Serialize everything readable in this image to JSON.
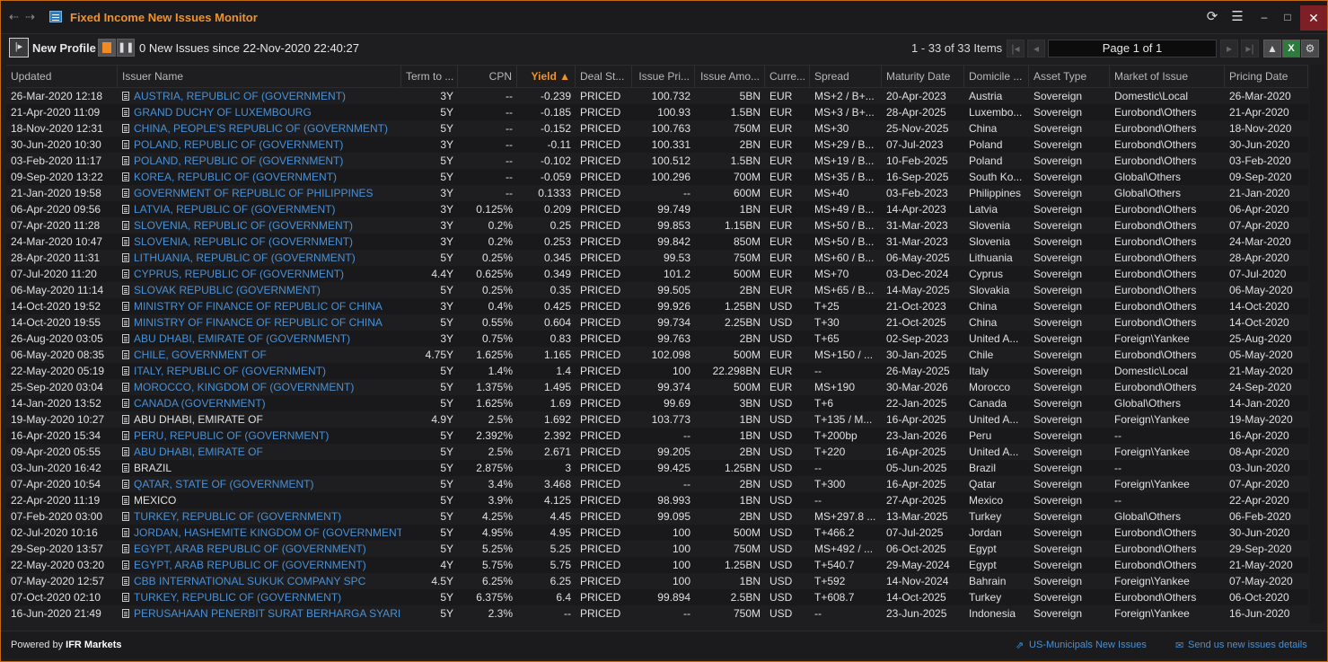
{
  "window": {
    "title": "Fixed Income New Issues Monitor",
    "back_icon": "arrow-left-icon",
    "forward_icon": "arrow-right-icon",
    "refresh_icon": "refresh-icon",
    "menu_icon": "hamburger-icon",
    "minimize": "‒",
    "maximize": "□",
    "close": "✕"
  },
  "toolbar": {
    "profile_label": "New Profile",
    "new_issues_text": "0 New Issues since 22-Nov-2020 22:40:27",
    "items_info": "1 - 33 of 33 Items",
    "page_label": "Page 1 of 1",
    "first_page": "|◂",
    "prev_page": "◂",
    "next_page": "▸",
    "last_page": "▸|"
  },
  "columns": [
    {
      "key": "updated",
      "label": "Updated"
    },
    {
      "key": "issuer",
      "label": "Issuer Name"
    },
    {
      "key": "term",
      "label": "Term to ..."
    },
    {
      "key": "cpn",
      "label": "CPN"
    },
    {
      "key": "yield",
      "label": "Yield ▲"
    },
    {
      "key": "deal",
      "label": "Deal St..."
    },
    {
      "key": "price",
      "label": "Issue Pri..."
    },
    {
      "key": "amount",
      "label": "Issue Amo..."
    },
    {
      "key": "curr",
      "label": "Curre..."
    },
    {
      "key": "spread",
      "label": "Spread"
    },
    {
      "key": "maturity",
      "label": "Maturity Date"
    },
    {
      "key": "domicile",
      "label": "Domicile ..."
    },
    {
      "key": "asset",
      "label": "Asset Type"
    },
    {
      "key": "market",
      "label": "Market of Issue"
    },
    {
      "key": "pricing",
      "label": "Pricing Date"
    }
  ],
  "rows": [
    {
      "updated": "26-Mar-2020 12:18",
      "issuer": "AUSTRIA, REPUBLIC OF (GOVERNMENT)",
      "link": true,
      "term": "3Y",
      "cpn": "--",
      "yield": "-0.239",
      "deal": "PRICED",
      "price": "100.732",
      "amount": "5BN",
      "curr": "EUR",
      "spread": "MS+2 / B+...",
      "maturity": "20-Apr-2023",
      "domicile": "Austria",
      "asset": "Sovereign",
      "market": "Domestic\\Local",
      "pricing": "26-Mar-2020"
    },
    {
      "updated": "21-Apr-2020 11:09",
      "issuer": "GRAND DUCHY OF LUXEMBOURG",
      "link": true,
      "term": "5Y",
      "cpn": "--",
      "yield": "-0.185",
      "deal": "PRICED",
      "price": "100.93",
      "amount": "1.5BN",
      "curr": "EUR",
      "spread": "MS+3 / B+...",
      "maturity": "28-Apr-2025",
      "domicile": "Luxembo...",
      "asset": "Sovereign",
      "market": "Eurobond\\Others",
      "pricing": "21-Apr-2020"
    },
    {
      "updated": "18-Nov-2020 12:31",
      "issuer": "CHINA, PEOPLE'S REPUBLIC OF (GOVERNMENT)",
      "link": true,
      "term": "5Y",
      "cpn": "--",
      "yield": "-0.152",
      "deal": "PRICED",
      "price": "100.763",
      "amount": "750M",
      "curr": "EUR",
      "spread": "MS+30",
      "maturity": "25-Nov-2025",
      "domicile": "China",
      "asset": "Sovereign",
      "market": "Eurobond\\Others",
      "pricing": "18-Nov-2020"
    },
    {
      "updated": "30-Jun-2020 10:30",
      "issuer": "POLAND, REPUBLIC OF (GOVERNMENT)",
      "link": true,
      "term": "3Y",
      "cpn": "--",
      "yield": "-0.11",
      "deal": "PRICED",
      "price": "100.331",
      "amount": "2BN",
      "curr": "EUR",
      "spread": "MS+29 / B...",
      "maturity": "07-Jul-2023",
      "domicile": "Poland",
      "asset": "Sovereign",
      "market": "Eurobond\\Others",
      "pricing": "30-Jun-2020"
    },
    {
      "updated": "03-Feb-2020 11:17",
      "issuer": "POLAND, REPUBLIC OF (GOVERNMENT)",
      "link": true,
      "term": "5Y",
      "cpn": "--",
      "yield": "-0.102",
      "deal": "PRICED",
      "price": "100.512",
      "amount": "1.5BN",
      "curr": "EUR",
      "spread": "MS+19 / B...",
      "maturity": "10-Feb-2025",
      "domicile": "Poland",
      "asset": "Sovereign",
      "market": "Eurobond\\Others",
      "pricing": "03-Feb-2020"
    },
    {
      "updated": "09-Sep-2020 13:22",
      "issuer": "KOREA, REPUBLIC OF (GOVERNMENT)",
      "link": true,
      "term": "5Y",
      "cpn": "--",
      "yield": "-0.059",
      "deal": "PRICED",
      "price": "100.296",
      "amount": "700M",
      "curr": "EUR",
      "spread": "MS+35 / B...",
      "maturity": "16-Sep-2025",
      "domicile": "South Ko...",
      "asset": "Sovereign",
      "market": "Global\\Others",
      "pricing": "09-Sep-2020"
    },
    {
      "updated": "21-Jan-2020 19:58",
      "issuer": "GOVERNMENT OF REPUBLIC OF PHILIPPINES",
      "link": true,
      "term": "3Y",
      "cpn": "--",
      "yield": "0.1333",
      "deal": "PRICED",
      "price": "--",
      "amount": "600M",
      "curr": "EUR",
      "spread": "MS+40",
      "maturity": "03-Feb-2023",
      "domicile": "Philippines",
      "asset": "Sovereign",
      "market": "Global\\Others",
      "pricing": "21-Jan-2020"
    },
    {
      "updated": "06-Apr-2020 09:56",
      "issuer": "LATVIA, REPUBLIC OF (GOVERNMENT)",
      "link": true,
      "term": "3Y",
      "cpn": "0.125%",
      "yield": "0.209",
      "deal": "PRICED",
      "price": "99.749",
      "amount": "1BN",
      "curr": "EUR",
      "spread": "MS+49 / B...",
      "maturity": "14-Apr-2023",
      "domicile": "Latvia",
      "asset": "Sovereign",
      "market": "Eurobond\\Others",
      "pricing": "06-Apr-2020"
    },
    {
      "updated": "07-Apr-2020 11:28",
      "issuer": "SLOVENIA, REPUBLIC OF (GOVERNMENT)",
      "link": true,
      "term": "3Y",
      "cpn": "0.2%",
      "yield": "0.25",
      "deal": "PRICED",
      "price": "99.853",
      "amount": "1.15BN",
      "curr": "EUR",
      "spread": "MS+50 / B...",
      "maturity": "31-Mar-2023",
      "domicile": "Slovenia",
      "asset": "Sovereign",
      "market": "Eurobond\\Others",
      "pricing": "07-Apr-2020"
    },
    {
      "updated": "24-Mar-2020 10:47",
      "issuer": "SLOVENIA, REPUBLIC OF (GOVERNMENT)",
      "link": true,
      "term": "3Y",
      "cpn": "0.2%",
      "yield": "0.253",
      "deal": "PRICED",
      "price": "99.842",
      "amount": "850M",
      "curr": "EUR",
      "spread": "MS+50 / B...",
      "maturity": "31-Mar-2023",
      "domicile": "Slovenia",
      "asset": "Sovereign",
      "market": "Eurobond\\Others",
      "pricing": "24-Mar-2020"
    },
    {
      "updated": "28-Apr-2020 11:31",
      "issuer": "LITHUANIA, REPUBLIC OF (GOVERNMENT)",
      "link": true,
      "term": "5Y",
      "cpn": "0.25%",
      "yield": "0.345",
      "deal": "PRICED",
      "price": "99.53",
      "amount": "750M",
      "curr": "EUR",
      "spread": "MS+60 / B...",
      "maturity": "06-May-2025",
      "domicile": "Lithuania",
      "asset": "Sovereign",
      "market": "Eurobond\\Others",
      "pricing": "28-Apr-2020"
    },
    {
      "updated": "07-Jul-2020 11:20",
      "issuer": "CYPRUS, REPUBLIC OF (GOVERNMENT)",
      "link": true,
      "term": "4.4Y",
      "cpn": "0.625%",
      "yield": "0.349",
      "deal": "PRICED",
      "price": "101.2",
      "amount": "500M",
      "curr": "EUR",
      "spread": "MS+70",
      "maturity": "03-Dec-2024",
      "domicile": "Cyprus",
      "asset": "Sovereign",
      "market": "Eurobond\\Others",
      "pricing": "07-Jul-2020"
    },
    {
      "updated": "06-May-2020 11:14",
      "issuer": "SLOVAK REPUBLIC (GOVERNMENT)",
      "link": true,
      "term": "5Y",
      "cpn": "0.25%",
      "yield": "0.35",
      "deal": "PRICED",
      "price": "99.505",
      "amount": "2BN",
      "curr": "EUR",
      "spread": "MS+65 / B...",
      "maturity": "14-May-2025",
      "domicile": "Slovakia",
      "asset": "Sovereign",
      "market": "Eurobond\\Others",
      "pricing": "06-May-2020"
    },
    {
      "updated": "14-Oct-2020 19:52",
      "issuer": "MINISTRY OF FINANCE OF REPUBLIC OF CHINA",
      "link": true,
      "term": "3Y",
      "cpn": "0.4%",
      "yield": "0.425",
      "deal": "PRICED",
      "price": "99.926",
      "amount": "1.25BN",
      "curr": "USD",
      "spread": "T+25",
      "maturity": "21-Oct-2023",
      "domicile": "China",
      "asset": "Sovereign",
      "market": "Eurobond\\Others",
      "pricing": "14-Oct-2020"
    },
    {
      "updated": "14-Oct-2020 19:55",
      "issuer": "MINISTRY OF FINANCE OF REPUBLIC OF CHINA",
      "link": true,
      "term": "5Y",
      "cpn": "0.55%",
      "yield": "0.604",
      "deal": "PRICED",
      "price": "99.734",
      "amount": "2.25BN",
      "curr": "USD",
      "spread": "T+30",
      "maturity": "21-Oct-2025",
      "domicile": "China",
      "asset": "Sovereign",
      "market": "Eurobond\\Others",
      "pricing": "14-Oct-2020"
    },
    {
      "updated": "26-Aug-2020 03:05",
      "issuer": "ABU DHABI, EMIRATE OF (GOVERNMENT)",
      "link": true,
      "term": "3Y",
      "cpn": "0.75%",
      "yield": "0.83",
      "deal": "PRICED",
      "price": "99.763",
      "amount": "2BN",
      "curr": "USD",
      "spread": "T+65",
      "maturity": "02-Sep-2023",
      "domicile": "United A...",
      "asset": "Sovereign",
      "market": "Foreign\\Yankee",
      "pricing": "25-Aug-2020"
    },
    {
      "updated": "06-May-2020 08:35",
      "issuer": "CHILE, GOVERNMENT OF",
      "link": true,
      "term": "4.75Y",
      "cpn": "1.625%",
      "yield": "1.165",
      "deal": "PRICED",
      "price": "102.098",
      "amount": "500M",
      "curr": "EUR",
      "spread": "MS+150 / ...",
      "maturity": "30-Jan-2025",
      "domicile": "Chile",
      "asset": "Sovereign",
      "market": "Eurobond\\Others",
      "pricing": "05-May-2020"
    },
    {
      "updated": "22-May-2020 05:19",
      "issuer": "ITALY, REPUBLIC OF (GOVERNMENT)",
      "link": true,
      "term": "5Y",
      "cpn": "1.4%",
      "yield": "1.4",
      "deal": "PRICED",
      "price": "100",
      "amount": "22.298BN",
      "curr": "EUR",
      "spread": "--",
      "maturity": "26-May-2025",
      "domicile": "Italy",
      "asset": "Sovereign",
      "market": "Domestic\\Local",
      "pricing": "21-May-2020"
    },
    {
      "updated": "25-Sep-2020 03:04",
      "issuer": "MOROCCO, KINGDOM OF (GOVERNMENT)",
      "link": true,
      "term": "5Y",
      "cpn": "1.375%",
      "yield": "1.495",
      "deal": "PRICED",
      "price": "99.374",
      "amount": "500M",
      "curr": "EUR",
      "spread": "MS+190",
      "maturity": "30-Mar-2026",
      "domicile": "Morocco",
      "asset": "Sovereign",
      "market": "Eurobond\\Others",
      "pricing": "24-Sep-2020"
    },
    {
      "updated": "14-Jan-2020 13:52",
      "issuer": "CANADA (GOVERNMENT)",
      "link": true,
      "term": "5Y",
      "cpn": "1.625%",
      "yield": "1.69",
      "deal": "PRICED",
      "price": "99.69",
      "amount": "3BN",
      "curr": "USD",
      "spread": "T+6",
      "maturity": "22-Jan-2025",
      "domicile": "Canada",
      "asset": "Sovereign",
      "market": "Global\\Others",
      "pricing": "14-Jan-2020"
    },
    {
      "updated": "19-May-2020 10:27",
      "issuer": "ABU DHABI, EMIRATE OF",
      "link": false,
      "term": "4.9Y",
      "cpn": "2.5%",
      "yield": "1.692",
      "deal": "PRICED",
      "price": "103.773",
      "amount": "1BN",
      "curr": "USD",
      "spread": "T+135 / M...",
      "maturity": "16-Apr-2025",
      "domicile": "United A...",
      "asset": "Sovereign",
      "market": "Foreign\\Yankee",
      "pricing": "19-May-2020"
    },
    {
      "updated": "16-Apr-2020 15:34",
      "issuer": "PERU, REPUBLIC OF (GOVERNMENT)",
      "link": true,
      "term": "5Y",
      "cpn": "2.392%",
      "yield": "2.392",
      "deal": "PRICED",
      "price": "--",
      "amount": "1BN",
      "curr": "USD",
      "spread": "T+200bp",
      "maturity": "23-Jan-2026",
      "domicile": "Peru",
      "asset": "Sovereign",
      "market": "--",
      "pricing": "16-Apr-2020"
    },
    {
      "updated": "09-Apr-2020 05:55",
      "issuer": "ABU DHABI, EMIRATE OF",
      "link": true,
      "term": "5Y",
      "cpn": "2.5%",
      "yield": "2.671",
      "deal": "PRICED",
      "price": "99.205",
      "amount": "2BN",
      "curr": "USD",
      "spread": "T+220",
      "maturity": "16-Apr-2025",
      "domicile": "United A...",
      "asset": "Sovereign",
      "market": "Foreign\\Yankee",
      "pricing": "08-Apr-2020"
    },
    {
      "updated": "03-Jun-2020 16:42",
      "issuer": "BRAZIL",
      "link": false,
      "term": "5Y",
      "cpn": "2.875%",
      "yield": "3",
      "deal": "PRICED",
      "price": "99.425",
      "amount": "1.25BN",
      "curr": "USD",
      "spread": "--",
      "maturity": "05-Jun-2025",
      "domicile": "Brazil",
      "asset": "Sovereign",
      "market": "--",
      "pricing": "03-Jun-2020"
    },
    {
      "updated": "07-Apr-2020 10:54",
      "issuer": "QATAR, STATE OF (GOVERNMENT)",
      "link": true,
      "term": "5Y",
      "cpn": "3.4%",
      "yield": "3.468",
      "deal": "PRICED",
      "price": "--",
      "amount": "2BN",
      "curr": "USD",
      "spread": "T+300",
      "maturity": "16-Apr-2025",
      "domicile": "Qatar",
      "asset": "Sovereign",
      "market": "Foreign\\Yankee",
      "pricing": "07-Apr-2020"
    },
    {
      "updated": "22-Apr-2020 11:19",
      "issuer": "MEXICO",
      "link": false,
      "term": "5Y",
      "cpn": "3.9%",
      "yield": "4.125",
      "deal": "PRICED",
      "price": "98.993",
      "amount": "1BN",
      "curr": "USD",
      "spread": "--",
      "maturity": "27-Apr-2025",
      "domicile": "Mexico",
      "asset": "Sovereign",
      "market": "--",
      "pricing": "22-Apr-2020"
    },
    {
      "updated": "07-Feb-2020 03:00",
      "issuer": "TURKEY, REPUBLIC OF (GOVERNMENT)",
      "link": true,
      "term": "5Y",
      "cpn": "4.25%",
      "yield": "4.45",
      "deal": "PRICED",
      "price": "99.095",
      "amount": "2BN",
      "curr": "USD",
      "spread": "MS+297.8 ...",
      "maturity": "13-Mar-2025",
      "domicile": "Turkey",
      "asset": "Sovereign",
      "market": "Global\\Others",
      "pricing": "06-Feb-2020"
    },
    {
      "updated": "02-Jul-2020 10:16",
      "issuer": "JORDAN, HASHEMITE KINGDOM OF (GOVERNMENT)",
      "link": true,
      "term": "5Y",
      "cpn": "4.95%",
      "yield": "4.95",
      "deal": "PRICED",
      "price": "100",
      "amount": "500M",
      "curr": "USD",
      "spread": "T+466.2",
      "maturity": "07-Jul-2025",
      "domicile": "Jordan",
      "asset": "Sovereign",
      "market": "Eurobond\\Others",
      "pricing": "30-Jun-2020"
    },
    {
      "updated": "29-Sep-2020 13:57",
      "issuer": "EGYPT, ARAB REPUBLIC OF (GOVERNMENT)",
      "link": true,
      "term": "5Y",
      "cpn": "5.25%",
      "yield": "5.25",
      "deal": "PRICED",
      "price": "100",
      "amount": "750M",
      "curr": "USD",
      "spread": "MS+492 / ...",
      "maturity": "06-Oct-2025",
      "domicile": "Egypt",
      "asset": "Sovereign",
      "market": "Eurobond\\Others",
      "pricing": "29-Sep-2020"
    },
    {
      "updated": "22-May-2020 03:20",
      "issuer": "EGYPT, ARAB REPUBLIC OF (GOVERNMENT)",
      "link": true,
      "term": "4Y",
      "cpn": "5.75%",
      "yield": "5.75",
      "deal": "PRICED",
      "price": "100",
      "amount": "1.25BN",
      "curr": "USD",
      "spread": "T+540.7",
      "maturity": "29-May-2024",
      "domicile": "Egypt",
      "asset": "Sovereign",
      "market": "Eurobond\\Others",
      "pricing": "21-May-2020"
    },
    {
      "updated": "07-May-2020 12:57",
      "issuer": "CBB INTERNATIONAL SUKUK COMPANY SPC",
      "link": true,
      "term": "4.5Y",
      "cpn": "6.25%",
      "yield": "6.25",
      "deal": "PRICED",
      "price": "100",
      "amount": "1BN",
      "curr": "USD",
      "spread": "T+592",
      "maturity": "14-Nov-2024",
      "domicile": "Bahrain",
      "asset": "Sovereign",
      "market": "Foreign\\Yankee",
      "pricing": "07-May-2020"
    },
    {
      "updated": "07-Oct-2020 02:10",
      "issuer": "TURKEY, REPUBLIC OF (GOVERNMENT)",
      "link": true,
      "term": "5Y",
      "cpn": "6.375%",
      "yield": "6.4",
      "deal": "PRICED",
      "price": "99.894",
      "amount": "2.5BN",
      "curr": "USD",
      "spread": "T+608.7",
      "maturity": "14-Oct-2025",
      "domicile": "Turkey",
      "asset": "Sovereign",
      "market": "Eurobond\\Others",
      "pricing": "06-Oct-2020"
    },
    {
      "updated": "16-Jun-2020 21:49",
      "issuer": "PERUSAHAAN PENERBIT SURAT BERHARGA SYARI...",
      "link": true,
      "term": "5Y",
      "cpn": "2.3%",
      "yield": "--",
      "deal": "PRICED",
      "price": "--",
      "amount": "750M",
      "curr": "USD",
      "spread": "--",
      "maturity": "23-Jun-2025",
      "domicile": "Indonesia",
      "asset": "Sovereign",
      "market": "Foreign\\Yankee",
      "pricing": "16-Jun-2020"
    }
  ],
  "footer": {
    "powered_prefix": "Powered by ",
    "powered_brand": "IFR Markets",
    "link_municipals": "US-Municipals New Issues",
    "link_send": "Send us new issues details"
  }
}
